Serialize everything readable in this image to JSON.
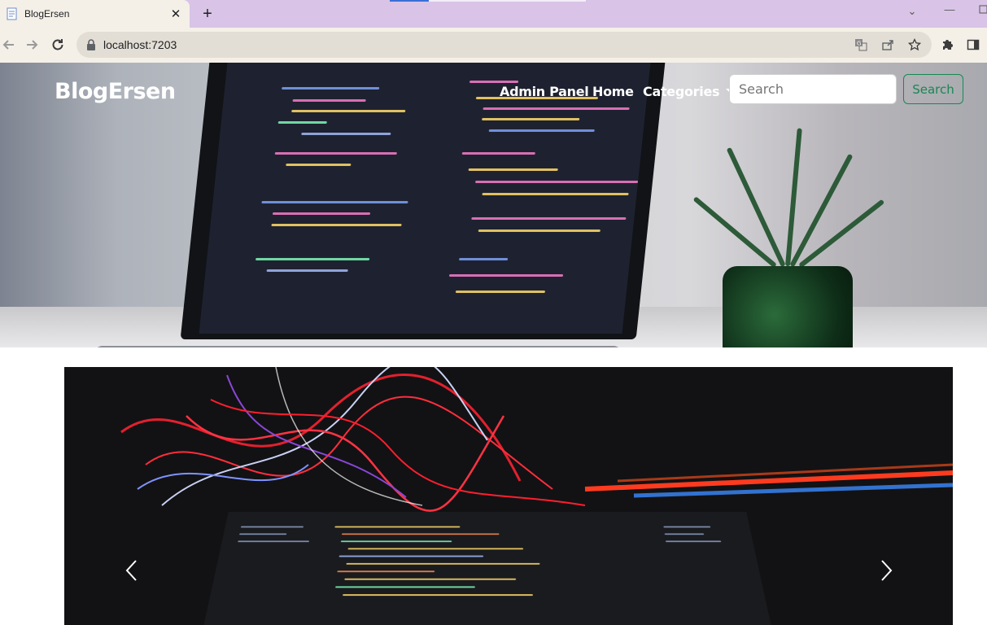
{
  "browser": {
    "tab": {
      "title": "BlogErsen",
      "close_glyph": "✕"
    },
    "new_tab_glyph": "+",
    "url": "localhost:7203",
    "window_controls": {
      "dropdown": "⌄",
      "minimize": "—"
    }
  },
  "navbar": {
    "brand": "BlogErsen",
    "links": [
      {
        "label": "Admin Panel"
      },
      {
        "label": "Home"
      },
      {
        "label": "Categories",
        "has_dropdown": true
      }
    ],
    "search": {
      "placeholder": "Search",
      "button_label": "Search"
    }
  },
  "colors": {
    "search_button": "#198754",
    "tab_strip": "#d9c3e6",
    "toolbar": "#f4f0e8"
  },
  "icons": {
    "tab_favicon": "document-icon",
    "back": "back-arrow-icon",
    "forward": "forward-arrow-icon",
    "reload": "reload-icon",
    "lock": "lock-icon",
    "translate": "translate-icon",
    "share": "share-icon",
    "bookmark": "star-icon",
    "extensions": "puzzle-icon",
    "side_panel": "side-panel-icon",
    "carousel_prev": "chevron-left-icon",
    "carousel_next": "chevron-right-icon"
  }
}
